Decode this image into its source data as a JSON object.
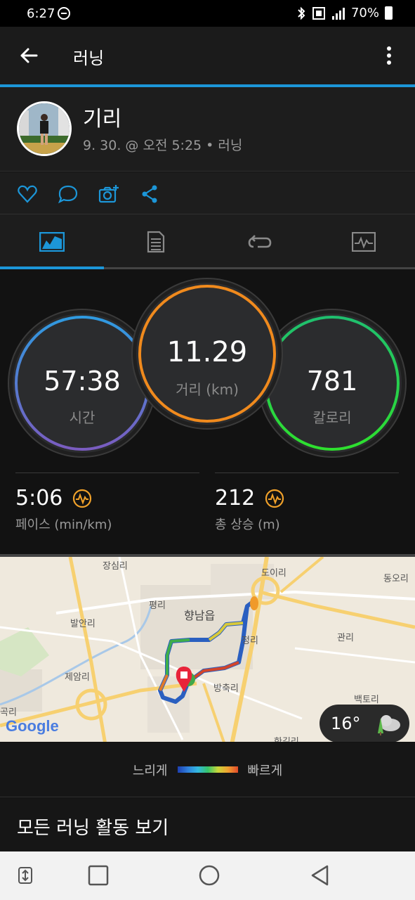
{
  "status_bar": {
    "time": "6:27",
    "battery": "70%"
  },
  "app_bar": {
    "title": "러닝"
  },
  "activity": {
    "name": "기리",
    "meta": "9. 30. @ 오전 5:25 • 러닝"
  },
  "rings": {
    "time": {
      "value": "57:38",
      "label": "시간",
      "color": "#3d94d6"
    },
    "distance": {
      "value": "11.29",
      "label": "거리 (km)",
      "color": "#f08a1d"
    },
    "calories": {
      "value": "781",
      "label": "칼로리",
      "color": "#2fd06a"
    }
  },
  "stats": {
    "pace": {
      "value": "5:06",
      "label": "페이스 (min/km)"
    },
    "ascent": {
      "value": "212",
      "label": "총 상승 (m)"
    }
  },
  "map": {
    "labels": [
      "장심리",
      "도이리",
      "동오리",
      "평리",
      "향남읍",
      "발안리",
      "정리",
      "관리",
      "제암리",
      "방축리",
      "백토리",
      "한길리",
      "곡리"
    ],
    "weather_temp": "16°",
    "attribution": "Google"
  },
  "legend": {
    "slow": "느리게",
    "fast": "빠르게"
  },
  "all_runs": "모든 러닝 활동 보기",
  "colors": {
    "accent": "#1c96d8"
  }
}
